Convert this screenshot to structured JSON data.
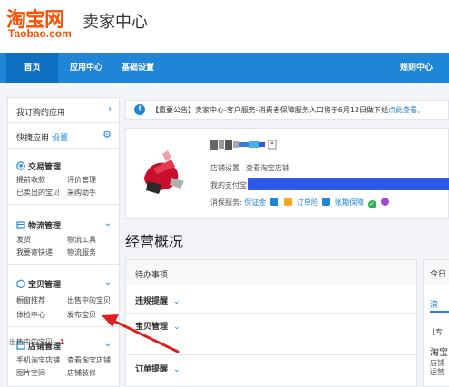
{
  "logo": {
    "cn": "淘宝网",
    "en": "Taobao.com",
    "title": "卖家中心",
    "color": "#ff5000"
  },
  "nav": {
    "home": "首页",
    "apps": "应用中心",
    "basic": "基础设置",
    "rules": "规则中心",
    "bg": "#1f85d6"
  },
  "sidebar": {
    "subscribed_apps": "我订购的应用",
    "quick_apps": "快捷应用",
    "quick_settings": "设置",
    "categories": [
      {
        "name": "交易管理",
        "icon": "transaction-icon",
        "links": [
          "提前收款",
          "评价管理",
          "已卖出的宝贝",
          "采购助手"
        ]
      },
      {
        "name": "物流管理",
        "icon": "logistics-icon",
        "links": [
          "发货",
          "物流工具",
          "我要寄快递",
          "物流服务"
        ]
      },
      {
        "name": "宝贝管理",
        "icon": "item-icon",
        "links": [
          "橱窗推荐",
          "出售中的宝贝",
          "体检中心",
          "发布宝贝"
        ]
      },
      {
        "name": "店铺管理",
        "icon": "store-icon",
        "links": [
          "手机淘宝店铺",
          "查看淘宝店铺",
          "图片空间",
          "店铺装修"
        ]
      }
    ]
  },
  "notice": {
    "text": "【重要公告】卖家中心-客户服务-消费者保障服务入口将于6月12日做下线",
    "link": "点此查看。"
  },
  "shop": {
    "links": [
      "店铺设置",
      "查看淘宝店铺"
    ],
    "alipay_label": "我的支付宝:",
    "guarantee_label": "消保服务:",
    "guarantee_items": [
      "保证金",
      "订单险",
      "账期保障"
    ]
  },
  "overview_title": "经营概况",
  "todo": {
    "header": "待办事项",
    "sections": [
      "违规提醒",
      "宝贝管理",
      "订单提醒"
    ],
    "selling_label": "出售中的宝贝:",
    "selling_count": "1"
  },
  "right_card": {
    "header": "今日",
    "tab": "滚",
    "line1": "【专",
    "line2": "淘宝",
    "line3": "店铺",
    "line4": "运营"
  }
}
